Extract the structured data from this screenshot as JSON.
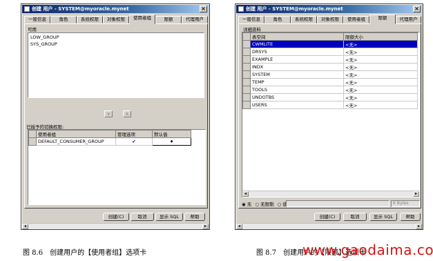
{
  "left": {
    "title": "创建 用户 - SYSTEM@myoracle.mynet",
    "tabs": [
      "一般信息",
      "角色",
      "系统权限",
      "对象权限",
      "使用者组",
      "限额",
      "代理用户"
    ],
    "active_tab": 4,
    "available_label": "可用",
    "available_items": [
      "LOW_GROUP",
      "SYS_GROUP"
    ],
    "granted_label": "已授予的切换权限:",
    "table_headers": [
      "使用者组",
      "管理选项",
      "默认值"
    ],
    "row": {
      "group": "DEFAULT_CONSUMER_GROUP",
      "admin": "✔",
      "default": "◆"
    },
    "buttons": [
      "创建(C)",
      "取消",
      "显示 SQL",
      "帮助"
    ],
    "down_arrow": "∨",
    "up_arrow": "∧"
  },
  "right": {
    "title": "创建 用户 - SYSTEM@myoracle.mynet",
    "tabs": [
      "一般信息",
      "角色",
      "系统权限",
      "对象权限",
      "使用者组",
      "限额",
      "代理用户"
    ],
    "active_tab": 5,
    "section_label": "详细资料",
    "headers": [
      "表空间",
      "限额大小"
    ],
    "rows": [
      {
        "name": "CWMLITE",
        "quota": "<无>"
      },
      {
        "name": "DRSYS",
        "quota": "<无>"
      },
      {
        "name": "EXAMPLE",
        "quota": "<无>"
      },
      {
        "name": "INDX",
        "quota": "<无>"
      },
      {
        "name": "SYSTEM",
        "quota": "<无>"
      },
      {
        "name": "TEMP",
        "quota": "<无>"
      },
      {
        "name": "TOOLS",
        "quota": "<无>"
      },
      {
        "name": "UNDOTBS",
        "quota": "<无>"
      },
      {
        "name": "USERS",
        "quota": "<无>"
      }
    ],
    "selected_row": 0,
    "quota_options": [
      "无",
      "无限制",
      "值"
    ],
    "unit": "K Bytes",
    "buttons": [
      "创建(C)",
      "取消",
      "显示 SQL",
      "帮助"
    ]
  },
  "captions": {
    "left": "图 8.6　创建用户的【使用者组】选项卡",
    "right": "图 8.7　创建用户的【限额】选项卡"
  },
  "watermark": "www.gaodaima.com"
}
